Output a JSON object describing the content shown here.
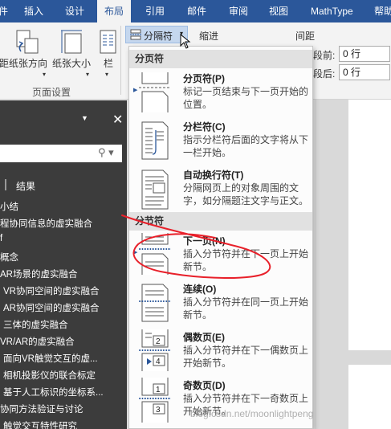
{
  "tabs": [
    "件",
    "插入",
    "设计",
    "布局",
    "引用",
    "邮件",
    "审阅",
    "视图",
    "MathType",
    "帮助"
  ],
  "active_tab": "布局",
  "ribbon": {
    "left_edge_label": "距",
    "text_direction": "纸张方向",
    "paper_size": "纸张大小",
    "columns": "栏",
    "breaks": "分隔符",
    "indent": "缩进",
    "spacing": "间距",
    "before_label": "段前:",
    "before_value": "0 行",
    "after_label": "段后:",
    "after_value": "0 行",
    "page_setup_group": "页面设置"
  },
  "nav": {
    "results_tab": "结果",
    "items": [
      "小结",
      "程协同信息的虚实融合",
      "f",
      "概念",
      "AR场景的虚实融合",
      "VR协同空间的虚实融合",
      "AR协同空间的虚实融合",
      "三体的虚实融合",
      "VR/AR的虚实融合",
      "面向VR触觉交互的虚...",
      "相机投影仪的联合标定",
      "基于人工标识的坐标系...",
      "协同方法验证与讨论",
      "触觉交互特性研究"
    ]
  },
  "menu": {
    "section_page_breaks": "分页符",
    "section_section_breaks": "分节符",
    "items": [
      {
        "title": "分页符(P)",
        "desc": "标记一页结束与下一页开始的位置。"
      },
      {
        "title": "分栏符(C)",
        "desc": "指示分栏符后面的文字将从下一栏开始。"
      },
      {
        "title": "自动换行符(T)",
        "desc": "分隔网页上的对象周围的文字，如分隔题注文字与正文。"
      },
      {
        "title": "下一页(N)",
        "desc": "插入分节符并在下一页上开始新节。"
      },
      {
        "title": "连续(O)",
        "desc": "插入分节符并在同一页上开始新节。"
      },
      {
        "title": "偶数页(E)",
        "desc": "插入分节符并在下一偶数页上开始新节。"
      },
      {
        "title": "奇数页(D)",
        "desc": "插入分节符并在下一奇数页上开始新节。"
      }
    ]
  },
  "icon_numbers": {
    "even_top": "2",
    "even_bottom": "4",
    "odd_top": "1",
    "odd_bottom": "3"
  },
  "watermark": "blog.csdn.net/moonlightpeng",
  "colors": {
    "ribbon_blue": "#2b579a",
    "annotation_red": "#e8202a"
  }
}
